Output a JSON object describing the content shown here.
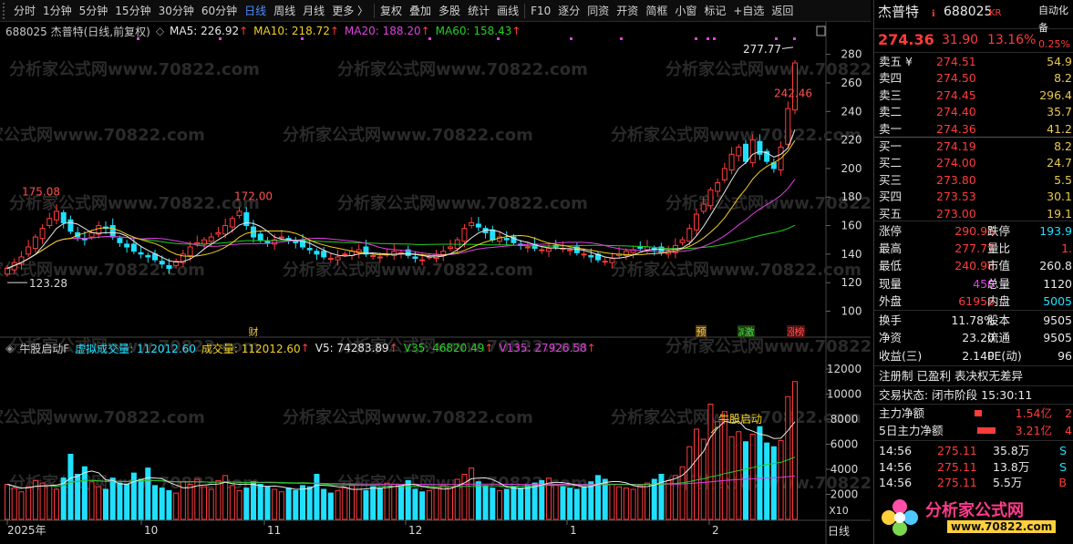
{
  "toolbar": {
    "items": [
      "分时",
      "1分钟",
      "5分钟",
      "15分钟",
      "30分钟",
      "60分钟",
      "日线",
      "周线",
      "月线",
      "更多 〉",
      "复权",
      "叠加",
      "多股",
      "统计",
      "画线",
      "F10",
      "逐分",
      "同资",
      "开资",
      "简框",
      "小窗",
      "标记",
      "+自选",
      "返回"
    ],
    "active": "日线"
  },
  "ma_legend": {
    "title": "688025 杰普特(日线,前复权)",
    "ma5": "MA5: 226.92",
    "ma10": "MA10: 218.72",
    "ma20": "MA20: 188.20",
    "ma60": "MA60: 158.43",
    "up_arrow": "↑",
    "colors": {
      "ma5": "#e8e8e8",
      "ma10": "#f0d020",
      "ma20": "#e040e0",
      "ma60": "#20d020"
    }
  },
  "vol_legend": {
    "name": "牛股启动F",
    "virtual": "虚拟成交量: 112012.60",
    "volume": "成交量: 112012.60",
    "v5": "V5: 74283.89",
    "v35": "V35: 46820.49",
    "v135": "V135: 27926.58",
    "up_arrow": "↑"
  },
  "watermark": "分析家公式网www.70822.com",
  "chart_data": [
    {
      "type": "candlestick",
      "title": "688025 杰普特(日线,前复权)",
      "y_ticks": [
        100,
        120,
        140,
        160,
        180,
        200,
        220,
        240,
        260,
        280
      ],
      "ylim": [
        92,
        290
      ],
      "annotations": {
        "high_label": "277.77",
        "low_label": "123.28",
        "peak1": "175.08",
        "peak2": "172.00",
        "recent": "242.46"
      },
      "event_tags": [
        "财",
        "预",
        "减",
        "激",
        "涨",
        "榜"
      ],
      "closes": [
        130,
        134,
        138,
        145,
        152,
        158,
        165,
        170,
        162,
        156,
        152,
        150,
        155,
        160,
        158,
        152,
        148,
        145,
        142,
        140,
        138,
        136,
        133,
        130,
        135,
        140,
        145,
        148,
        150,
        152,
        155,
        160,
        165,
        170,
        160,
        152,
        150,
        148,
        150,
        152,
        150,
        148,
        145,
        143,
        140,
        138,
        137,
        138,
        140,
        142,
        143,
        140,
        139,
        138,
        140,
        142,
        141,
        139,
        137,
        136,
        138,
        140,
        142,
        145,
        150,
        158,
        162,
        159,
        155,
        150,
        152,
        150,
        148,
        146,
        145,
        144,
        143,
        144,
        145,
        144,
        143,
        141,
        140,
        138,
        136,
        135,
        137,
        140,
        142,
        143,
        144,
        145,
        143,
        141,
        142,
        146,
        150,
        158,
        168,
        175,
        185,
        190,
        200,
        210,
        215,
        205,
        220,
        210,
        205,
        200,
        215,
        242,
        274
      ],
      "x_labels": [
        "2025年",
        "10",
        "11",
        "12",
        "1",
        "2"
      ]
    },
    {
      "type": "bar",
      "title": "牛股启动F",
      "y_ticks": [
        2000,
        4000,
        6000,
        8000,
        10000,
        12000
      ],
      "ylim": [
        0,
        12800
      ],
      "unit_label": "X10",
      "annotation": "牛股启动",
      "volumes": [
        2800,
        2500,
        2200,
        2600,
        3100,
        2900,
        2700,
        2400,
        3300,
        5200,
        3600,
        4200,
        3000,
        2600,
        2400,
        3300,
        2900,
        2800,
        3700,
        3200,
        4100,
        2700,
        2500,
        2300,
        2100,
        3000,
        2800,
        3200,
        2600,
        2400,
        3100,
        3500,
        2700,
        2300,
        2500,
        3000,
        2800,
        2600,
        2400,
        2200,
        2500,
        2300,
        2700,
        2600,
        3600,
        2400,
        2100,
        2300,
        2500,
        2700,
        2400,
        2300,
        2600,
        2500,
        2900,
        2800,
        2700,
        3100,
        2400,
        2200,
        2300,
        2500,
        2700,
        2600,
        3200,
        3600,
        4100,
        3000,
        2700,
        2500,
        2300,
        2400,
        2600,
        2500,
        2700,
        2900,
        3100,
        3300,
        2800,
        2600,
        2500,
        2400,
        2600,
        3000,
        3500,
        3200,
        2800,
        2600,
        2500,
        2400,
        2700,
        2900,
        3200,
        3600,
        3100,
        3500,
        4200,
        5800,
        7200,
        6400,
        9200,
        7800,
        8600,
        6600,
        7000,
        6200,
        6800,
        7400,
        6100,
        5800,
        6300,
        9800,
        11000
      ]
    }
  ],
  "panel": {
    "name": "杰普特",
    "code": "688025",
    "tag": "KR",
    "price": "274.36",
    "change": "31.90",
    "pct": "13.16%",
    "auto_label": "自动化",
    "auto_value": "0.25%",
    "auto_sub": "备",
    "asks": [
      {
        "label": "卖五 ¥",
        "price": "274.51",
        "vol": "54.9"
      },
      {
        "label": "卖四",
        "price": "274.50",
        "vol": "8.2"
      },
      {
        "label": "卖三",
        "price": "274.45",
        "vol": "296.4"
      },
      {
        "label": "卖二",
        "price": "274.40",
        "vol": "35.7"
      },
      {
        "label": "卖一",
        "price": "274.36",
        "vol": "41.2"
      }
    ],
    "bids": [
      {
        "label": "买一",
        "price": "274.19",
        "vol": "8.2"
      },
      {
        "label": "买二",
        "price": "274.00",
        "vol": "24.7"
      },
      {
        "label": "买三",
        "price": "273.80",
        "vol": "5.5"
      },
      {
        "label": "买四",
        "price": "273.53",
        "vol": "30.1"
      },
      {
        "label": "买五",
        "price": "273.00",
        "vol": "19.1"
      }
    ],
    "stats": [
      {
        "l1": "涨停",
        "v1": "290.95",
        "c1": "red",
        "l2": "跌停",
        "v2": "193.9",
        "c2": "cyan"
      },
      {
        "l1": "最高",
        "v1": "277.77",
        "c1": "red",
        "l2": "量比",
        "v2": "1.",
        "c2": "red"
      },
      {
        "l1": "最低",
        "v1": "240.98",
        "c1": "red",
        "l2": "市值",
        "v2": "260.8",
        "c2": "white"
      },
      {
        "l1": "现量",
        "v1": "450",
        "c1": "magenta",
        "l2": "总量",
        "v2": "1120",
        "c2": "white"
      },
      {
        "l1": "外盘",
        "v1": "61958",
        "c1": "red",
        "l2": "内盘",
        "v2": "5005",
        "c2": "cyan"
      }
    ],
    "stats2": [
      {
        "l1": "换手",
        "v1": "11.78%",
        "c1": "white",
        "l2": "股本",
        "v2": "9505",
        "c2": "white"
      },
      {
        "l1": "净资",
        "v1": "23.20",
        "c1": "white",
        "l2": "流通",
        "v2": "9505",
        "c2": "white"
      },
      {
        "l1": "收益(三)",
        "v1": "2.140",
        "c1": "white",
        "l2": "PE(动)",
        "v2": "96",
        "c2": "white"
      }
    ],
    "reg": "注册制 已盈利 表决权无差异",
    "status": "交易状态: 闭市阶段 15:30:11",
    "flow": [
      {
        "label": "主力净额",
        "value": "1.54亿",
        "tail": "2"
      },
      {
        "label": "5日主力净额",
        "value": "3.21亿",
        "tail": "4"
      }
    ],
    "ticks": [
      {
        "time": "14:56",
        "price": "275.11",
        "vol": "35.8万",
        "side": "S"
      },
      {
        "time": "14:56",
        "price": "275.11",
        "vol": "13.8万",
        "side": "S"
      },
      {
        "time": "14:56",
        "price": "275.11",
        "vol": "5.5万",
        "side": "B"
      }
    ],
    "logo_text": "分析家公式网",
    "logo_url": "www.70822.com"
  },
  "bottom_tab": "日线"
}
